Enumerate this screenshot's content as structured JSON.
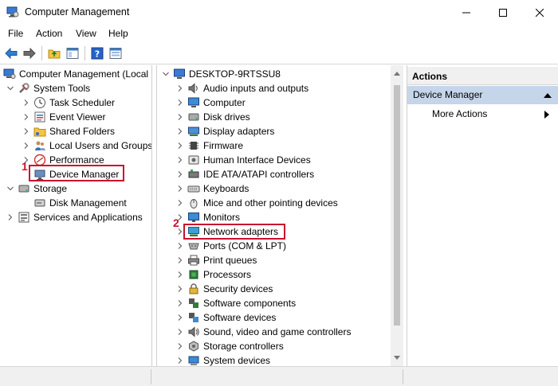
{
  "window": {
    "title": "Computer Management"
  },
  "menu": [
    "File",
    "Action",
    "View",
    "Help"
  ],
  "toolbar": [
    "back-arrow",
    "forward-arrow",
    "folder-up",
    "show-hide-tree",
    "help",
    "properties"
  ],
  "left_tree": {
    "root": "Computer Management (Local",
    "items": [
      {
        "label": "System Tools",
        "level": 1,
        "expander": "expanded"
      },
      {
        "label": "Task Scheduler",
        "level": 2,
        "expander": "collapsed"
      },
      {
        "label": "Event Viewer",
        "level": 2,
        "expander": "collapsed"
      },
      {
        "label": "Shared Folders",
        "level": 2,
        "expander": "collapsed"
      },
      {
        "label": "Local Users and Groups",
        "level": 2,
        "expander": "collapsed"
      },
      {
        "label": "Performance",
        "level": 2,
        "expander": "collapsed"
      },
      {
        "label": "Device Manager",
        "level": 2,
        "expander": "none",
        "selected": true
      },
      {
        "label": "Storage",
        "level": 1,
        "expander": "expanded"
      },
      {
        "label": "Disk Management",
        "level": 2,
        "expander": "none"
      },
      {
        "label": "Services and Applications",
        "level": 1,
        "expander": "collapsed"
      }
    ]
  },
  "device_tree": {
    "root": "DESKTOP-9RTSSU8",
    "categories": [
      "Audio inputs and outputs",
      "Computer",
      "Disk drives",
      "Display adapters",
      "Firmware",
      "Human Interface Devices",
      "IDE ATA/ATAPI controllers",
      "Keyboards",
      "Mice and other pointing devices",
      "Monitors",
      "Network adapters",
      "Ports (COM & LPT)",
      "Print queues",
      "Processors",
      "Security devices",
      "Software components",
      "Software devices",
      "Sound, video and game controllers",
      "Storage controllers",
      "System devices"
    ]
  },
  "actions": {
    "header": "Actions",
    "section": "Device Manager",
    "items": [
      "More Actions"
    ]
  },
  "callouts": {
    "one": "1",
    "two": "2"
  },
  "colors": {
    "highlight_box": "#c8102e",
    "section_bg": "#c5d5ea",
    "accent_blue": "#1e6fc5"
  }
}
